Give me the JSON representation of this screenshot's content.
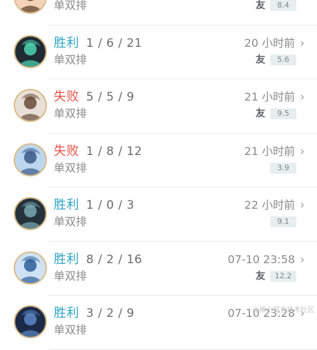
{
  "matches": [
    {
      "result": "",
      "kda": "",
      "mode": "单双排",
      "time": "",
      "friend": true,
      "score": "8.4",
      "outcome": "win",
      "avatar_icon": "champion-avatar-icon",
      "colors": {
        "bg": "#f2d3b6",
        "fg": "#5a3a2a"
      }
    },
    {
      "result": "胜利",
      "kda": "1 / 6 / 21",
      "mode": "单双排",
      "time": "20 小时前",
      "friend": true,
      "score": "5.6",
      "outcome": "win",
      "avatar_icon": "champion-avatar-icon",
      "colors": {
        "bg": "#1f2a33",
        "fg": "#4fd6b0"
      }
    },
    {
      "result": "失败",
      "kda": "5 / 5 / 9",
      "mode": "单双排",
      "time": "21 小时前",
      "friend": true,
      "score": "9.5",
      "outcome": "loss",
      "avatar_icon": "champion-avatar-icon",
      "colors": {
        "bg": "#e8e0d6",
        "fg": "#6a4a3a"
      }
    },
    {
      "result": "失败",
      "kda": "1 / 8 / 12",
      "mode": "单双排",
      "time": "21 小时前",
      "friend": false,
      "score": "3.9",
      "outcome": "loss",
      "avatar_icon": "champion-avatar-icon",
      "colors": {
        "bg": "#bcd6ef",
        "fg": "#3a5a8a"
      }
    },
    {
      "result": "胜利",
      "kda": "1 / 0 / 3",
      "mode": "单双排",
      "time": "22 小时前",
      "friend": false,
      "score": "9.1",
      "outcome": "win",
      "avatar_icon": "champion-avatar-icon",
      "colors": {
        "bg": "#25323a",
        "fg": "#79a7b5"
      }
    },
    {
      "result": "胜利",
      "kda": "8 / 2 / 16",
      "mode": "单双排",
      "time": "07-10 23:58",
      "friend": true,
      "score": "12.2",
      "outcome": "win",
      "avatar_icon": "champion-avatar-icon",
      "colors": {
        "bg": "#cfe2f5",
        "fg": "#2e5f9a"
      }
    },
    {
      "result": "胜利",
      "kda": "3 / 2 / 9",
      "mode": "单双排",
      "time": "07-10 23:28",
      "friend": false,
      "score": "",
      "outcome": "win",
      "avatar_icon": "champion-avatar-icon",
      "colors": {
        "bg": "#1c2a48",
        "fg": "#5a86c5"
      }
    }
  ],
  "friend_glyph": "友",
  "chevron_glyph": "›",
  "watermark": "@稀土掘金技术社区"
}
